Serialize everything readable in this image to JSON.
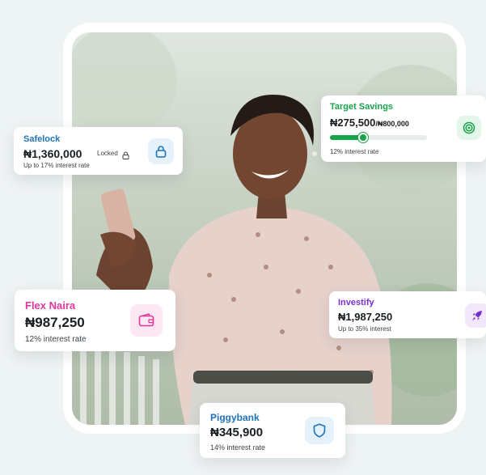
{
  "colors": {
    "background": "#eef3f3",
    "safelock_accent": "#1f73b8",
    "target_accent": "#17a34a",
    "flex_accent": "#e0389a",
    "investify_accent": "#7b2fd0",
    "piggybank_accent": "#1f73b8"
  },
  "hero": {
    "photo": "smiling-woman-holding-phone"
  },
  "cards": {
    "safelock": {
      "title": "Safelock",
      "amount": "₦1,360,000",
      "status": "Locked",
      "subtitle": "Up to 17% interest rate",
      "icon": "lock-icon"
    },
    "target_savings": {
      "title": "Target Savings",
      "amount": "₦275,500",
      "goal": "/₦800,000",
      "progress_fraction": 0.344,
      "subtitle": "12% interest rate",
      "icon": "target-icon"
    },
    "flex_naira": {
      "title": "Flex Naira",
      "amount": "₦987,250",
      "subtitle": "12% interest rate",
      "icon": "wallet-icon"
    },
    "investify": {
      "title": "Investify",
      "amount": "₦1,987,250",
      "subtitle": "Up to 35% interest",
      "icon": "rocket-icon"
    },
    "piggybank": {
      "title": "Piggybank",
      "amount": "₦345,900",
      "subtitle": "14% interest rate",
      "icon": "shield-icon"
    }
  }
}
